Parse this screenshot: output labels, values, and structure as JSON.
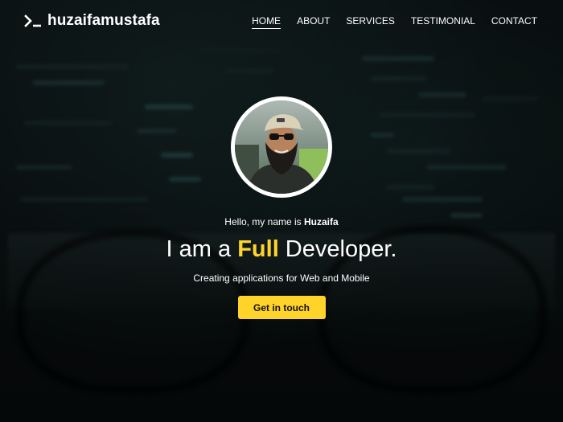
{
  "brand": {
    "icon": "terminal-prompt-icon",
    "name": "huzaifamustafa"
  },
  "nav": {
    "items": [
      {
        "label": "HOME",
        "active": true
      },
      {
        "label": "ABOUT",
        "active": false
      },
      {
        "label": "SERVICES",
        "active": false
      },
      {
        "label": "TESTIMONIAL",
        "active": false
      },
      {
        "label": "CONTACT",
        "active": false
      }
    ]
  },
  "hero": {
    "greeting_prefix": "Hello, my name is ",
    "greeting_name": "Huzaifa",
    "headline_prefix": "I am a ",
    "headline_highlight": "Full",
    "headline_suffix": " Developer.",
    "subtitle": "Creating applications for Web and Mobile",
    "cta_label": "Get in touch"
  },
  "colors": {
    "accent": "#ffd42a",
    "text": "#ffffff",
    "background": "#0b0f10"
  }
}
